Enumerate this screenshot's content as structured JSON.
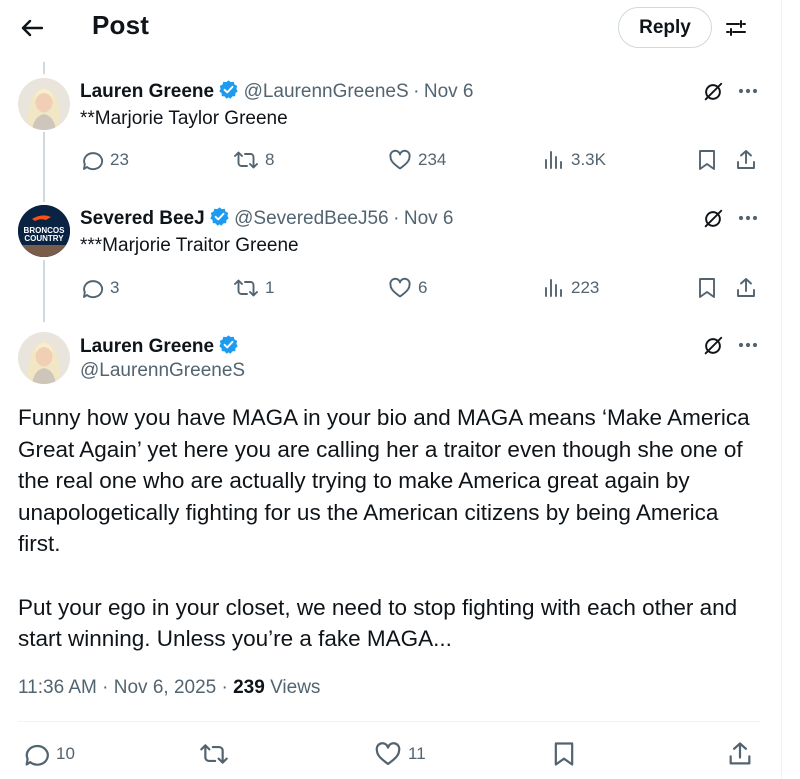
{
  "header": {
    "title": "Post",
    "reply_label": "Reply"
  },
  "thread": [
    {
      "name": "Lauren Greene",
      "handle": "@LaurennGreeneS",
      "date": "Nov 6",
      "text": "**Marjorie Taylor Greene",
      "replies": "23",
      "reposts": "8",
      "likes": "234",
      "views": "3.3K"
    },
    {
      "name": "Severed BeeJ",
      "handle": "@SeveredBeeJ56",
      "date": "Nov 6",
      "text": "***Marjorie Traitor Greene",
      "avatar_text": "BRONCOS COUNTRY",
      "replies": "3",
      "reposts": "1",
      "likes": "6",
      "views": "223"
    }
  ],
  "main": {
    "name": "Lauren Greene",
    "handle": "@LaurennGreeneS",
    "paragraphs": [
      "Funny how you have MAGA in your bio and MAGA means ‘Make America Great Again’ yet here you are calling her a traitor even though she one of the real one who are actually trying to make America great again by unapologetically fighting for us the American citizens by being America first.",
      "Put your ego in your closet, we need to stop fighting with each other and start winning. Unless you’re a fake MAGA..."
    ],
    "timestamp": "11:36 AM · Nov 6, 2025 · ",
    "views_count": "239",
    "views_label": " Views",
    "replies": "10",
    "likes": "11"
  },
  "colors": {
    "accent": "#1d9bf0",
    "secondary_text": "#536471",
    "border": "#cfd9de",
    "broncos_navy": "#0a2343",
    "broncos_orange": "#fb4f14"
  },
  "icons": [
    "back-arrow-icon",
    "settings-sliders-icon",
    "verified-badge-icon",
    "grok-icon",
    "more-icon",
    "reply-icon",
    "repost-icon",
    "like-icon",
    "views-icon",
    "bookmark-icon",
    "share-icon"
  ]
}
